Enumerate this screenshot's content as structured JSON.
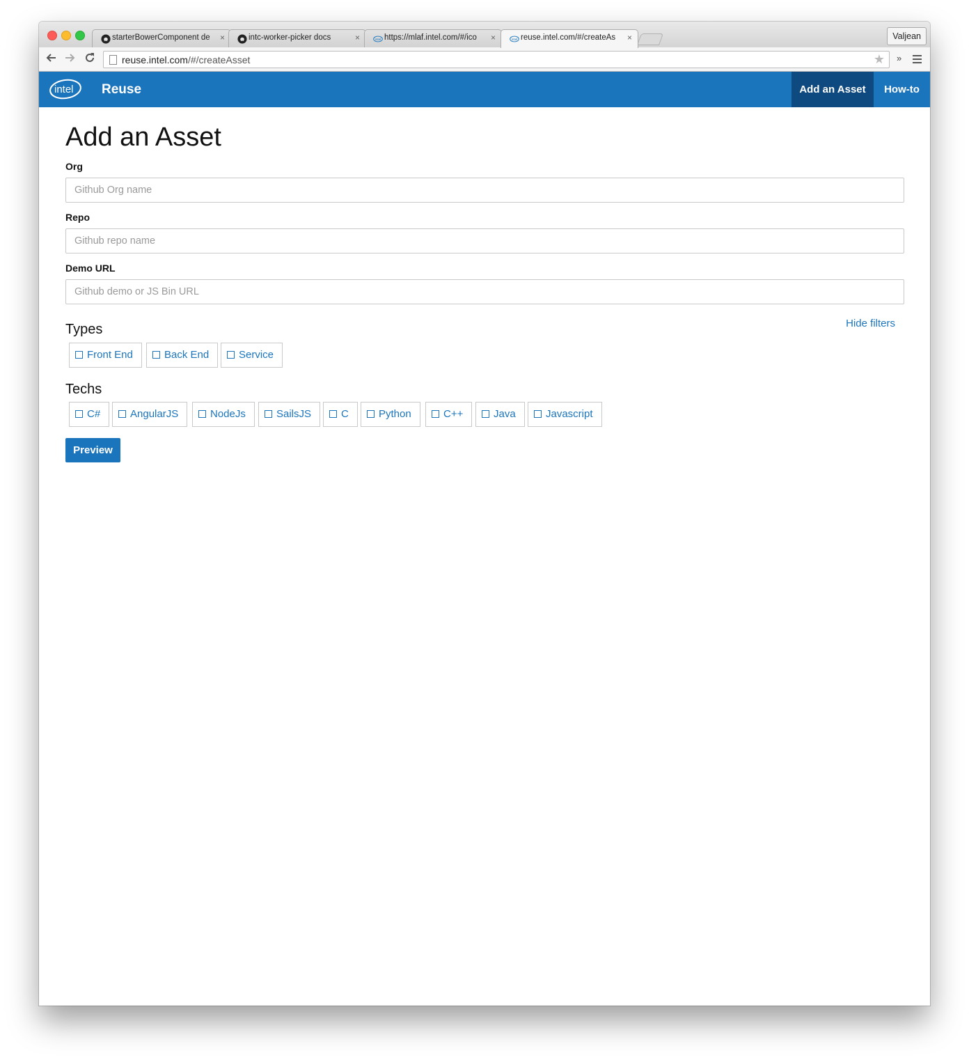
{
  "browser": {
    "tabs": [
      {
        "title": "starterBowerComponent de",
        "favicon": "github-icon",
        "active": false
      },
      {
        "title": "intc-worker-picker docs",
        "favicon": "github-icon",
        "active": false
      },
      {
        "title": "https://mlaf.intel.com/#/ico",
        "favicon": "intel-icon",
        "active": false
      },
      {
        "title": "reuse.intel.com/#/createAs",
        "favicon": "intel-icon",
        "active": true
      }
    ],
    "close_glyph": "×",
    "profile_name": "Valjean",
    "url_host": "reuse.intel.com",
    "url_path": "/#/createAsset",
    "more_glyph": "»"
  },
  "appbar": {
    "logo_text": "intel",
    "brand": "Reuse",
    "nav": {
      "add_asset": "Add an Asset",
      "howto": "How-to"
    },
    "color": "#1b75bc",
    "active_color": "#0e4a7f"
  },
  "form": {
    "title": "Add an Asset",
    "org": {
      "label": "Org",
      "placeholder": "Github Org name",
      "value": ""
    },
    "repo": {
      "label": "Repo",
      "placeholder": "Github repo name",
      "value": ""
    },
    "demo": {
      "label": "Demo URL",
      "placeholder": "Github demo or JS Bin URL",
      "value": ""
    },
    "hide_filters": "Hide filters",
    "types": {
      "label": "Types",
      "options": [
        "Front End",
        "Back End",
        "Service"
      ]
    },
    "techs": {
      "label": "Techs",
      "options": [
        "C#",
        "AngularJS",
        "NodeJs",
        "SailsJS",
        "C",
        "Python",
        "C++",
        "Java",
        "Javascript"
      ]
    },
    "preview_label": "Preview"
  }
}
